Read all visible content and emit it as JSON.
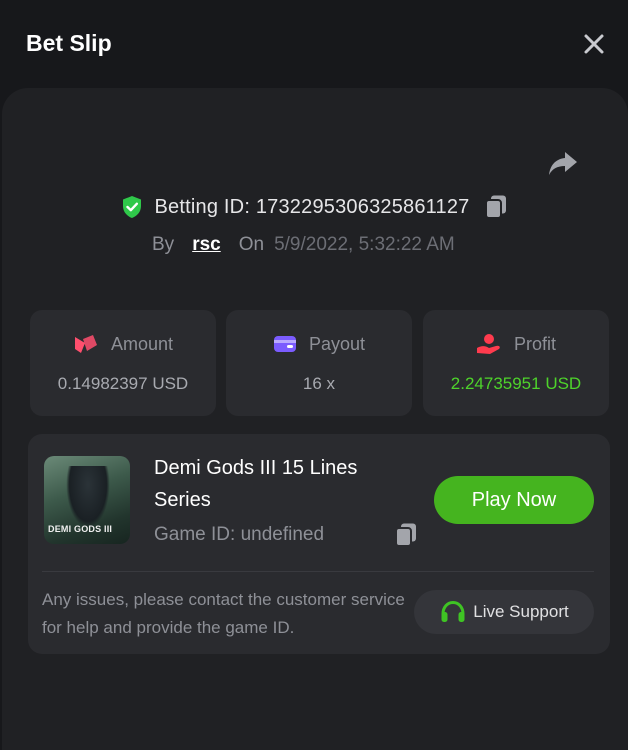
{
  "header": {
    "title": "Bet Slip"
  },
  "bet": {
    "betting_id_label": "Betting ID: 1732295306325861127",
    "by_label": "By",
    "user": "rsc",
    "on_label": "On",
    "date": "5/9/2022, 5:32:22 AM"
  },
  "stats": [
    {
      "label": "Amount",
      "value": "0.14982397 USD",
      "icon": "amount-icon",
      "color": "#ff4f6e"
    },
    {
      "label": "Payout",
      "value": "16 x",
      "icon": "wallet-icon",
      "color": "#7b5cff"
    },
    {
      "label": "Profit",
      "value": "2.24735951 USD",
      "icon": "profit-hand-icon",
      "color": "#ff3b4e"
    }
  ],
  "game": {
    "thumbnail_text": "DEMI GODS III",
    "name": "Demi Gods III 15 Lines Series",
    "id_label": "Game ID: undefined",
    "play_label": "Play Now"
  },
  "support": {
    "help_text": "Any issues, please contact the customer service for help and provide the game ID.",
    "button_label": "Live Support"
  },
  "colors": {
    "accent_green": "#45b41f",
    "profit_green": "#4ed32b",
    "shield_green": "#2fc84a"
  }
}
